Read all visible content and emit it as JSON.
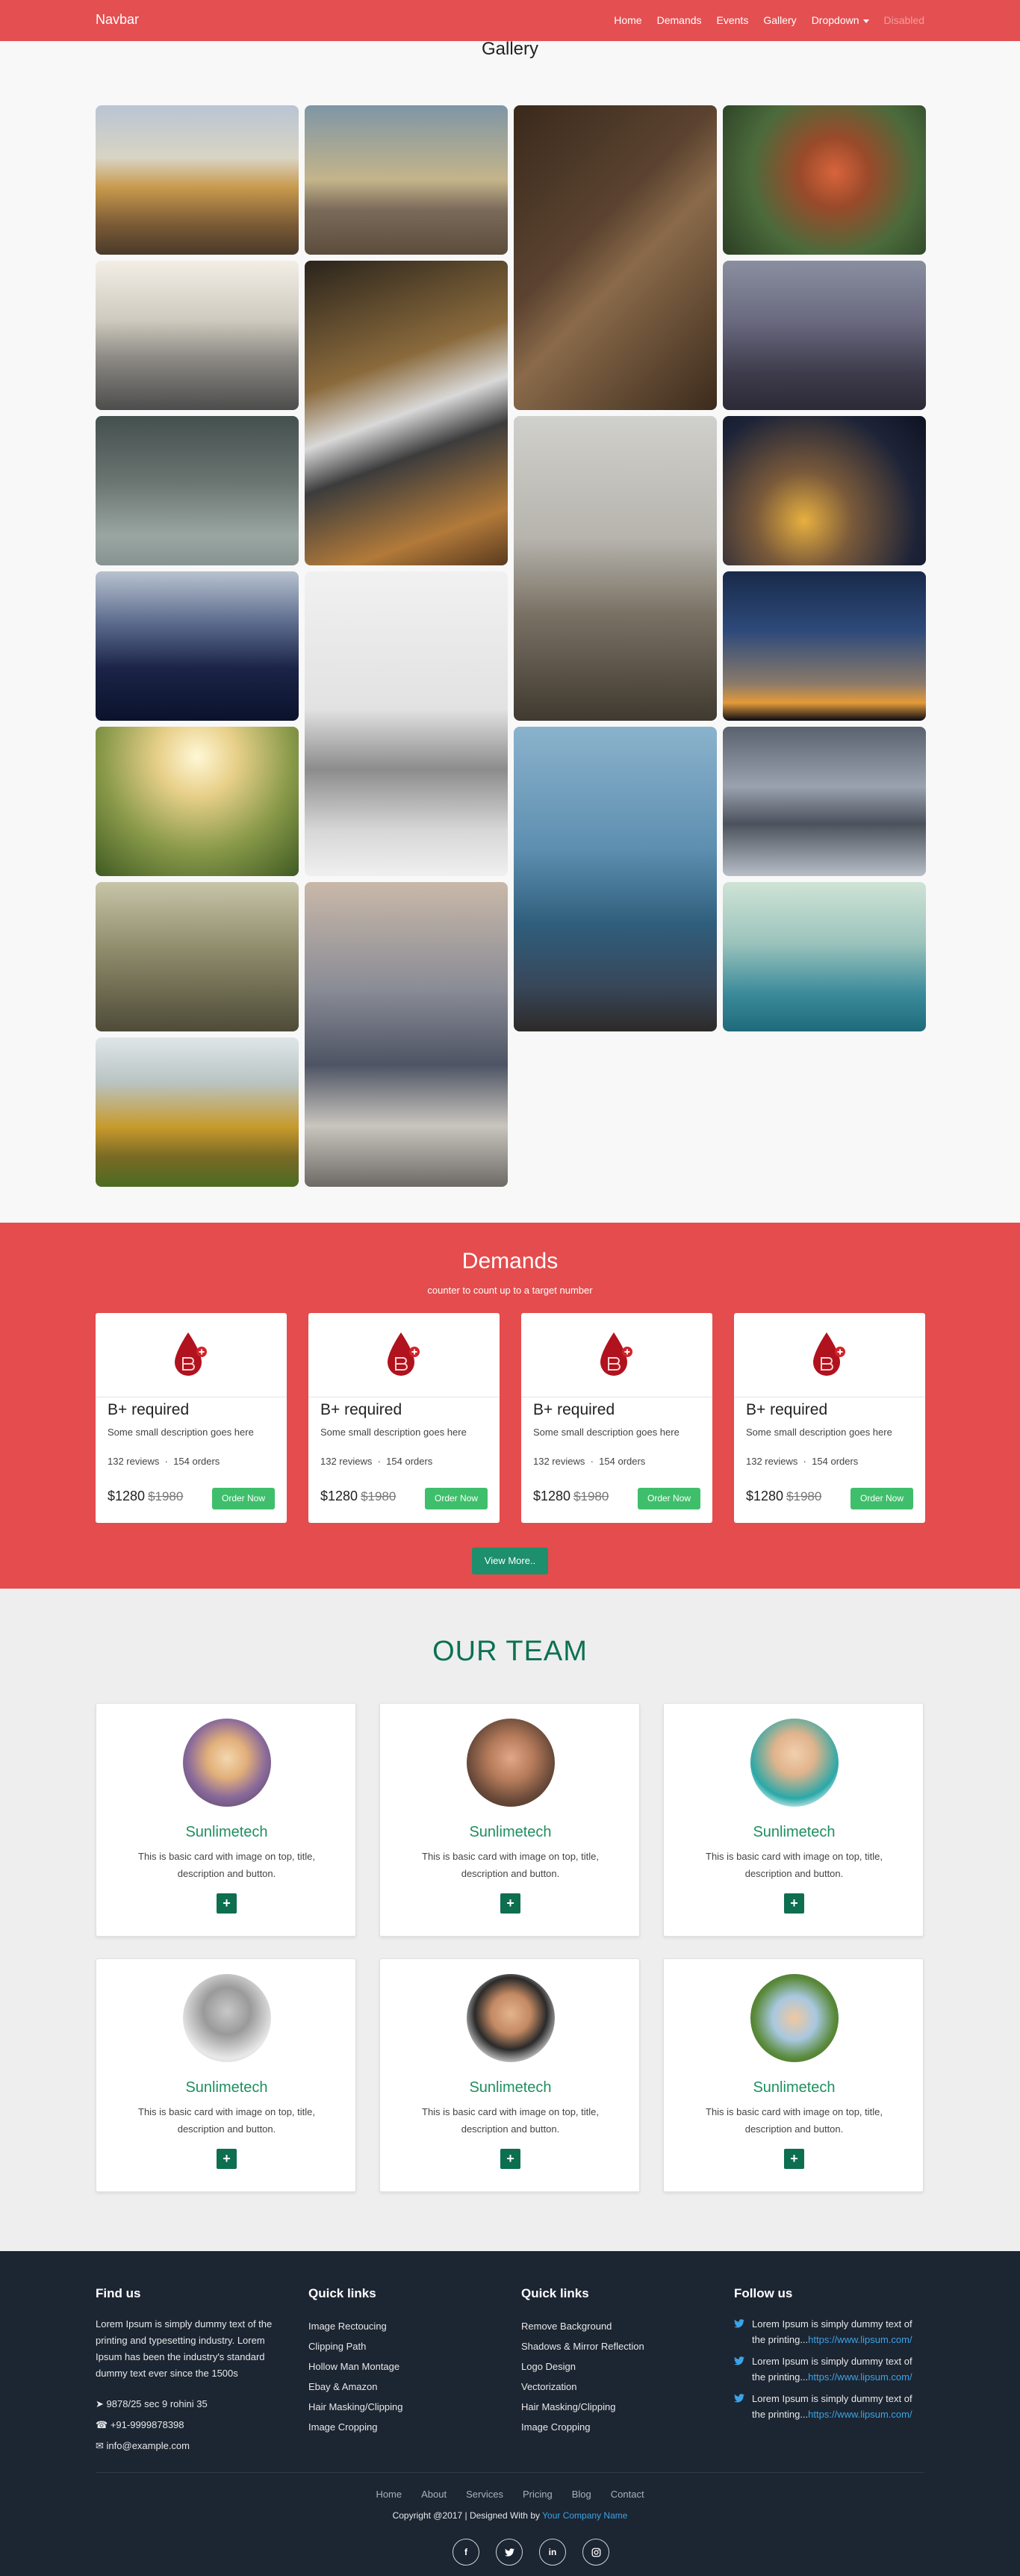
{
  "navbar": {
    "brand": "Navbar",
    "links": [
      "Home",
      "Demands",
      "Events",
      "Gallery",
      "Dropdown"
    ],
    "disabled_link": "Disabled"
  },
  "gallery": {
    "title": "Gallery",
    "images": [
      "tram-street-photo",
      "sunset-shore-photo",
      "tools-on-wood-photo",
      "red-tulips-photo",
      "city-skyline-photo",
      "laptop-coffee-photo",
      "misty-forest-photo",
      "cloudy-sky-photo",
      "church-dome-photo",
      "city-lights-night-photo",
      "ocean-waves-photo",
      "mountain-clouds-photo",
      "silhouette-dusk-photo",
      "girl-in-field-photo",
      "sea-rocks-photo",
      "coastal-mountains-photo",
      "hiker-mountain-photo",
      "backpack-traveller-photo",
      "cable-car-photo",
      "boat-bow-photo"
    ]
  },
  "demands": {
    "title": "Demands",
    "subtitle": "counter to count up to a target number",
    "cards": [
      {
        "title": "B+ required",
        "desc": "Some small description goes here",
        "reviews": "132 reviews",
        "orders": "154 orders",
        "price": "$1280",
        "old_price": "$1980",
        "button": "Order Now"
      },
      {
        "title": "B+ required",
        "desc": "Some small description goes here",
        "reviews": "132 reviews",
        "orders": "154 orders",
        "price": "$1280",
        "old_price": "$1980",
        "button": "Order Now"
      },
      {
        "title": "B+ required",
        "desc": "Some small description goes here",
        "reviews": "132 reviews",
        "orders": "154 orders",
        "price": "$1280",
        "old_price": "$1980",
        "button": "Order Now"
      },
      {
        "title": "B+ required",
        "desc": "Some small description goes here",
        "reviews": "132 reviews",
        "orders": "154 orders",
        "price": "$1280",
        "old_price": "$1980",
        "button": "Order Now"
      }
    ],
    "view_more": "View More.."
  },
  "team": {
    "title": "OUR TEAM",
    "members": [
      {
        "name": "Sunlimetech",
        "desc": "This is basic card with image on top, title, description and button.",
        "button": "+"
      },
      {
        "name": "Sunlimetech",
        "desc": "This is basic card with image on top, title, description and button.",
        "button": "+"
      },
      {
        "name": "Sunlimetech",
        "desc": "This is basic card with image on top, title, description and button.",
        "button": "+"
      },
      {
        "name": "Sunlimetech",
        "desc": "This is basic card with image on top, title, description and button.",
        "button": "+"
      },
      {
        "name": "Sunlimetech",
        "desc": "This is basic card with image on top, title, description and button.",
        "button": "+"
      },
      {
        "name": "Sunlimetech",
        "desc": "This is basic card with image on top, title, description and button.",
        "button": "+"
      }
    ]
  },
  "footer": {
    "find_us": {
      "title": "Find us",
      "text": "Lorem Ipsum is simply dummy text of the printing and typesetting industry. Lorem Ipsum has been the industry's standard dummy text ever since the 1500s",
      "address": "9878/25 sec 9 rohini 35",
      "phone": "+91-9999878398",
      "email": "info@example.com"
    },
    "quick_links_1": {
      "title": "Quick links",
      "links": [
        "Image Rectoucing",
        "Clipping Path",
        "Hollow Man Montage",
        "Ebay & Amazon",
        "Hair Masking/Clipping",
        "Image Cropping"
      ]
    },
    "quick_links_2": {
      "title": "Quick links",
      "links": [
        "Remove Background",
        "Shadows & Mirror Reflection",
        "Logo Design",
        "Vectorization",
        "Hair Masking/Clipping",
        "Image Cropping"
      ]
    },
    "follow_us": {
      "title": "Follow us",
      "tweets": [
        {
          "text": "Lorem Ipsum is simply dummy text of the printing...",
          "link": "https://www.lipsum.com/"
        },
        {
          "text": "Lorem Ipsum is simply dummy text of the printing...",
          "link": "https://www.lipsum.com/"
        },
        {
          "text": "Lorem Ipsum is simply dummy text of the printing...",
          "link": "https://www.lipsum.com/"
        }
      ]
    },
    "bottom_links": [
      "Home",
      "About",
      "Services",
      "Pricing",
      "Blog",
      "Contact"
    ],
    "copyright": "Copyright @2017 | Designed With by",
    "company": "Your Company Name",
    "social": [
      "facebook-icon",
      "twitter-icon",
      "linkedin-icon",
      "instagram-icon"
    ]
  },
  "colors": {
    "navbar": "#e44f51",
    "demands_bg": "#e44c4d",
    "team_title": "#0c7153",
    "member_name": "#1e8f5f",
    "footer_bg": "#1c2532",
    "order_button": "#3fbf6b"
  }
}
